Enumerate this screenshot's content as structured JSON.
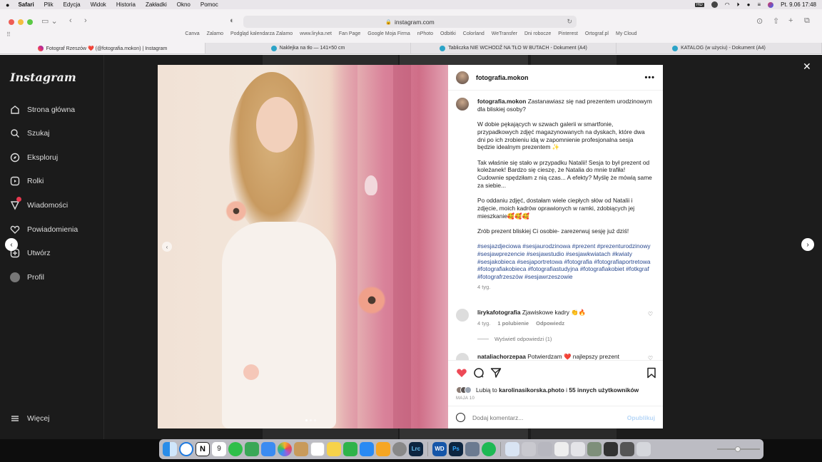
{
  "menubar": {
    "app": "Safari",
    "items": [
      "Plik",
      "Edycja",
      "Widok",
      "Historia",
      "Zakładki",
      "Okno",
      "Pomoc"
    ],
    "datetime": "Pt. 9.06  17:48"
  },
  "browser": {
    "url": "instagram.com",
    "bookmarks": [
      "Canva",
      "Zalamo",
      "Podgląd kalendarza Zalamo",
      "www.liryka.net",
      "Fan Page",
      "Google Moja Firma",
      "nPhoto",
      "Odbitki",
      "Colorland",
      "WeTransfer",
      "Dni robocze",
      "Pinterest",
      "Ortograf.pl",
      "My Cloud"
    ],
    "tabs": [
      {
        "label": "Fotograf Rzeszów ❤️ (@fotografia.mokon) | Instagram",
        "active": true
      },
      {
        "label": "Naklejka na tło — 141×50 cm",
        "active": false
      },
      {
        "label": "Tabliczka NIE WCHODŹ NA TŁO W BUTACH - Dokument (A4)",
        "active": false
      },
      {
        "label": "KATALOG (w użyciu) - Dokument (A4)",
        "active": false
      }
    ]
  },
  "instagram": {
    "logo": "Instagram",
    "nav": [
      {
        "label": "Strona główna",
        "icon": "home-icon"
      },
      {
        "label": "Szukaj",
        "icon": "search-icon"
      },
      {
        "label": "Eksploruj",
        "icon": "compass-icon"
      },
      {
        "label": "Rolki",
        "icon": "reels-icon"
      },
      {
        "label": "Wiadomości",
        "icon": "messenger-icon"
      },
      {
        "label": "Powiadomienia",
        "icon": "heart-icon"
      },
      {
        "label": "Utwórz",
        "icon": "plus-icon"
      },
      {
        "label": "Profil",
        "icon": "profile-avatar"
      }
    ],
    "more": "Więcej"
  },
  "post": {
    "username": "fotografia.mokon",
    "caption_intro": "Zastanawiasz się nad prezentem urodzinowym dla bliskiej osoby?",
    "caption_p2": "W dobie pękających w szwach galerii w smartfonie, przypadkowych zdjęć magazynowanych na dyskach, które dwa dni po ich zrobieniu idą w zapomnienie profesjonalna sesja będzie idealnym prezentem ✨",
    "caption_p3": "Tak właśnie się stało w przypadku Natalii! Sesja to był prezent od koleżanek! Bardzo się cieszę, że Natalia do mnie trafiła! Cudownie spędziłam z nią czas... A efekty? Myślę że mówią same za siebie...",
    "caption_p4": "Po oddaniu zdjęć, dostałam wiele ciepłych słów od Natalii i zdjęcie, moich kadrów oprawionych w ramki, zdobiących jej mieszkanie🥰🥰🥰",
    "caption_p5": "Zrób prezent bliskiej Ci osobie- zarezerwuj sesję już dziś!",
    "hashtags": "#sesjazdjeciowa #sesjaurodzinowa #prezent #prezenturodzinowy #sesjawprezencie #sesjawstudio #sesjawkwiatach #kwiaty #sesjakobieca #sesjaportretowa #fotografia #fotografiaportretowa #fotografiakobieca #fotografiastudyjna #fotografiakobiet #fotkgraf #fotografrzeszów #sesjawrzeszowie",
    "caption_time": "4 tyg.",
    "comments": [
      {
        "user": "lirykafotografia",
        "text": "Zjawiskowe kadry 👏🔥",
        "time": "4 tyg.",
        "likes": "1 polubienie",
        "reply": "Odpowiedz"
      },
      {
        "user": "nataliachorzepaa",
        "text": "Potwierdzam ❤️ najlepszy prezent",
        "time": "",
        "likes": "",
        "reply": ""
      }
    ],
    "view_replies": "Wyświetl odpowiedzi (1)",
    "likes_prefix": "Lubią to",
    "likes_user": "karolinasikorska.photo",
    "likes_connector": "i",
    "likes_others": "55 innych użytkowników",
    "date": "MAJA 10",
    "comment_placeholder": "Dodaj komentarz...",
    "post_button": "Opublikuj"
  },
  "dock": {
    "calendar_day": "9",
    "icons": [
      "finder-icon",
      "safari-icon",
      "notion-icon",
      "calendar-icon",
      "messages-icon",
      "mail-icon",
      "photos-icon",
      "notes-icon",
      "reminders-icon",
      "numbers-icon",
      "appstore-icon",
      "pages-icon",
      "settings-icon",
      "lightroom-icon",
      "wd-icon",
      "photoshop-icon",
      "transfer-icon",
      "spotify-icon"
    ]
  }
}
